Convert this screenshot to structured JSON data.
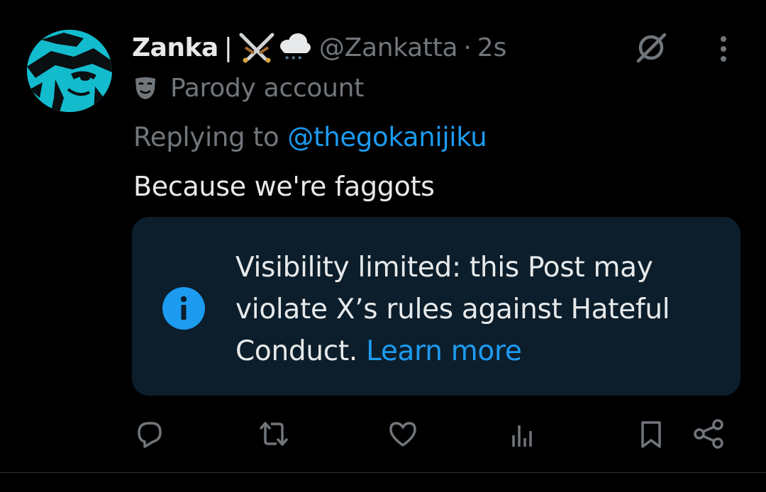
{
  "user": {
    "display_name": "Zanka",
    "name_separator": "|",
    "name_emojis": [
      "crossed-swords-icon",
      "snow-cloud-icon"
    ],
    "handle": "@Zankatta",
    "separator_dot": "·",
    "timestamp": "2s",
    "badge_icon": "parody-mask-icon",
    "badge_label": "Parody account"
  },
  "reply": {
    "prefix": "Replying to",
    "handle": "@thegokanijiku"
  },
  "tweet": {
    "text": "Because we're faggots"
  },
  "notice": {
    "icon": "info-icon",
    "text": "Visibility limited: this Post may violate X’s rules against Hateful Conduct.",
    "link_label": "Learn more"
  },
  "actions": [
    "reply-icon",
    "repost-icon",
    "like-icon",
    "views-icon",
    "bookmark-icon",
    "share-icon"
  ],
  "colors": {
    "background": "#000000",
    "primary_text": "#e7e9ea",
    "secondary_text": "#71767b",
    "accent": "#1d9bf0",
    "notice_background": "#0c1e2b"
  }
}
